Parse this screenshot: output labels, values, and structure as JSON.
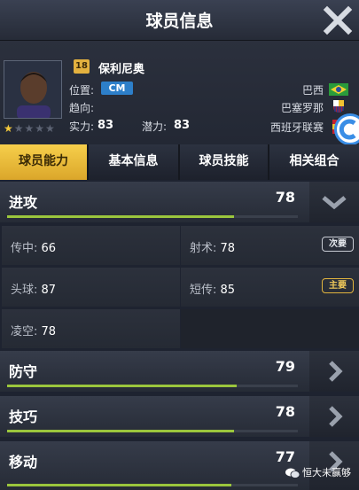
{
  "header": {
    "title": "球员信息",
    "close_icon": "close-icon"
  },
  "player": {
    "level": "18",
    "name": "保利尼奥",
    "position_label": "位置:",
    "position": "CM",
    "foot_label": "趋向:",
    "strength_label": "实力:",
    "strength": "83",
    "potential_label": "潜力:",
    "potential": "83",
    "stars_filled": 1,
    "stars_total": 5,
    "nationality": "巴西",
    "club": "巴塞罗那",
    "league": "西班牙联赛"
  },
  "tabs": [
    {
      "label": "球员能力",
      "active": true
    },
    {
      "label": "基本信息",
      "active": false
    },
    {
      "label": "球员技能",
      "active": false
    },
    {
      "label": "相关组合",
      "active": false
    }
  ],
  "sections": {
    "attack": {
      "label": "进攻",
      "value": "78",
      "expanded": true
    },
    "defense": {
      "label": "防守",
      "value": "79",
      "expanded": false
    },
    "skill": {
      "label": "技巧",
      "value": "78",
      "expanded": false
    },
    "movement": {
      "label": "移动",
      "value": "77",
      "expanded": false
    }
  },
  "attack_attributes": [
    {
      "label": "传中:",
      "value": "66",
      "tag": ""
    },
    {
      "label": "射术:",
      "value": "78",
      "tag": "次要"
    },
    {
      "label": "头球:",
      "value": "87",
      "tag": ""
    },
    {
      "label": "短传:",
      "value": "85",
      "tag": "主要"
    },
    {
      "label": "凌空:",
      "value": "78",
      "tag": ""
    }
  ],
  "watermark": "恒大未赢够",
  "colors": {
    "accent_gold": "#f6cf4b",
    "bar_green": "#9bc63d",
    "position_blue": "#2d7fc9"
  }
}
